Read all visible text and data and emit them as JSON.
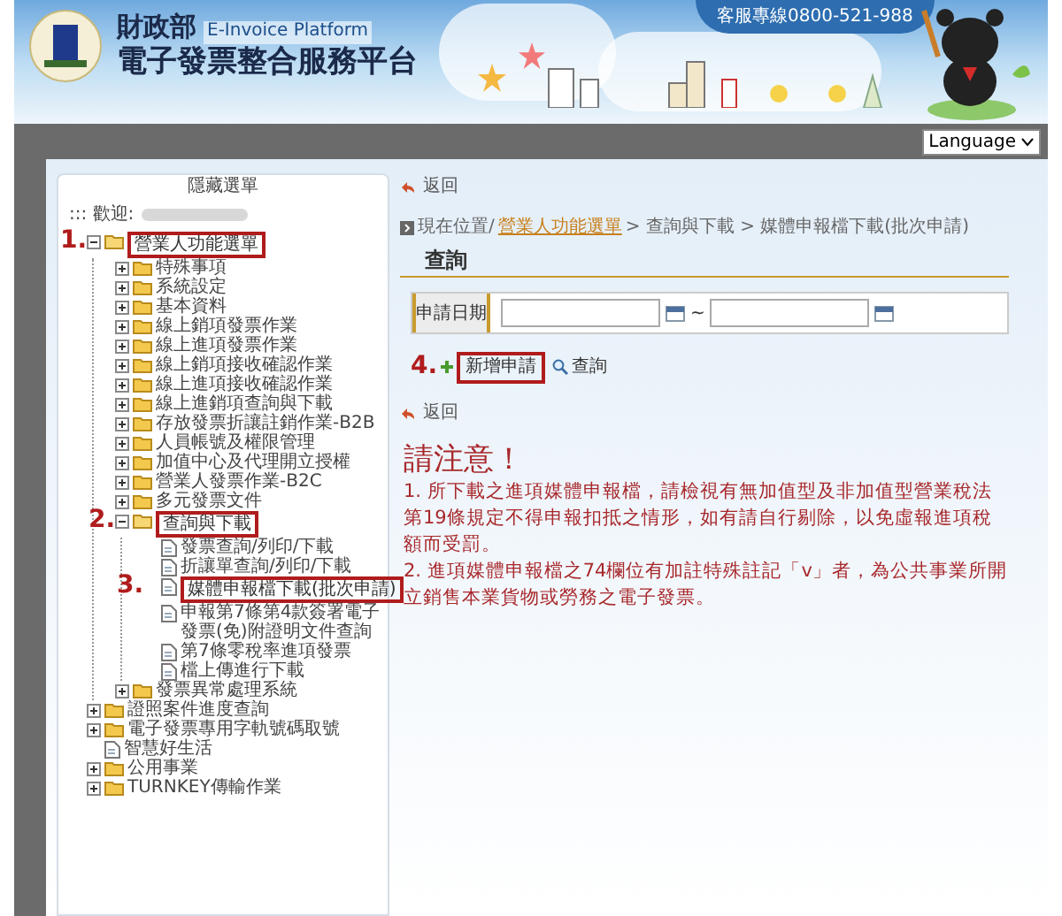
{
  "header": {
    "agency": "財政部",
    "platform_en": "E-Invoice Platform",
    "platform_zh": "電子發票整合服務平台",
    "hotline": "客服專線0800-521-988"
  },
  "language_select": {
    "value": "Language"
  },
  "sidebar": {
    "title": "隱藏選單",
    "welcome": "::: 歡迎:",
    "tree": [
      {
        "kind": "folder",
        "label": "營業人功能選單",
        "expanded": true,
        "step": "1.",
        "children": [
          {
            "kind": "folder",
            "label": "特殊事項",
            "expanded": false
          },
          {
            "kind": "folder",
            "label": "系統設定",
            "expanded": false
          },
          {
            "kind": "folder",
            "label": "基本資料",
            "expanded": false
          },
          {
            "kind": "folder",
            "label": "線上銷項發票作業",
            "expanded": false
          },
          {
            "kind": "folder",
            "label": "線上進項發票作業",
            "expanded": false
          },
          {
            "kind": "folder",
            "label": "線上銷項接收確認作業",
            "expanded": false
          },
          {
            "kind": "folder",
            "label": "線上進項接收確認作業",
            "expanded": false
          },
          {
            "kind": "folder",
            "label": "線上進銷項查詢與下載",
            "expanded": false
          },
          {
            "kind": "folder",
            "label": "存放發票折讓註銷作業-B2B",
            "expanded": false
          },
          {
            "kind": "folder",
            "label": "人員帳號及權限管理",
            "expanded": false
          },
          {
            "kind": "folder",
            "label": "加值中心及代理開立授權",
            "expanded": false
          },
          {
            "kind": "folder",
            "label": "營業人發票作業-B2C",
            "expanded": false
          },
          {
            "kind": "folder",
            "label": "多元發票文件",
            "expanded": false
          },
          {
            "kind": "folder",
            "label": "查詢與下載",
            "expanded": true,
            "step": "2.",
            "children": [
              {
                "kind": "doc",
                "label": "發票查詢/列印/下載"
              },
              {
                "kind": "doc",
                "label": "折讓單查詢/列印/下載"
              },
              {
                "kind": "doc",
                "label": "媒體申報檔下載(批次申請)",
                "step": "3."
              },
              {
                "kind": "doc",
                "label": "申報第7條第4款簽署電子發票(免)附證明文件查詢"
              },
              {
                "kind": "doc",
                "label": "第7條零稅率進項發票"
              },
              {
                "kind": "doc",
                "label": "檔上傳進行下載"
              }
            ]
          },
          {
            "kind": "folder",
            "label": "發票異常處理系統",
            "expanded": false
          }
        ]
      },
      {
        "kind": "folder",
        "label": "證照案件進度查詢",
        "expanded": false
      },
      {
        "kind": "folder",
        "label": "電子發票專用字軌號碼取號",
        "expanded": false
      },
      {
        "kind": "doc",
        "label": "智慧好生活"
      },
      {
        "kind": "folder",
        "label": "公用事業",
        "expanded": false
      },
      {
        "kind": "folder",
        "label": "TURNKEY傳輸作業",
        "expanded": false
      }
    ]
  },
  "content": {
    "back_top": "返回",
    "breadcrumb": {
      "prefix": "現在位置/",
      "link": "營業人功能選單",
      "rest": " > 查詢與下載 > 媒體申報檔下載(批次申請)"
    },
    "section_title": "查詢",
    "form": {
      "label": "申請日期",
      "separator": "~"
    },
    "actions": [
      {
        "kind": "add",
        "label": "新增申請",
        "step": "4."
      },
      {
        "kind": "search",
        "label": "查詢"
      }
    ],
    "back_bottom": "返回",
    "notice": {
      "title": "請注意！",
      "lines": [
        "1. 所下載之進項媒體申報檔，請檢視有無加值型及非加值型營業稅法第19條規定不得申報扣抵之情形，如有請自行剔除，以免虛報進項稅額而受罰。",
        "2. 進項媒體申報檔之74欄位有加註特殊註記「v」者，為公共事業所開立銷售本業貨物或勞務之電子發票。"
      ]
    }
  }
}
